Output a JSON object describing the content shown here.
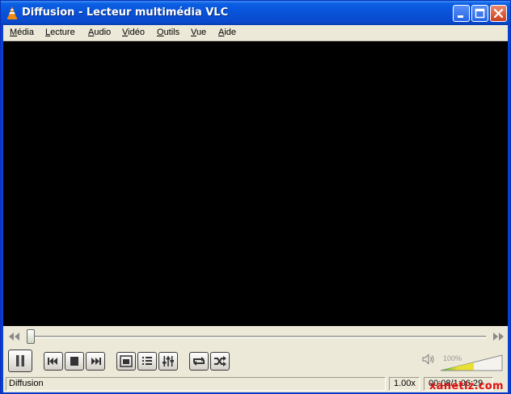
{
  "window": {
    "title": "Diffusion - Lecteur multimédia VLC",
    "icon": "vlc-cone-icon"
  },
  "menu": [
    {
      "accel": "M",
      "rest": "édia"
    },
    {
      "accel": "L",
      "rest": "ecture"
    },
    {
      "accel": "A",
      "rest": "udio"
    },
    {
      "accel": "V",
      "rest": "idéo"
    },
    {
      "accel": "O",
      "rest": "utils"
    },
    {
      "accel": "V",
      "rest": "ue"
    },
    {
      "accel": "A",
      "rest": "ide"
    }
  ],
  "playback": {
    "progress_fraction": 0.004
  },
  "controls": {
    "pause": "pause-icon",
    "previous": "previous-icon",
    "stop": "stop-icon",
    "next": "next-icon",
    "fullscreen": "fullscreen-icon",
    "playlist": "playlist-icon",
    "extended": "equalizer-icon",
    "loop": "loop-icon",
    "shuffle": "shuffle-icon"
  },
  "volume": {
    "label": "100%",
    "level": 1.0
  },
  "status": {
    "text": "Diffusion",
    "speed": "1.00x",
    "time": "00:08/1:06:29"
  },
  "watermark": "xanetiz.com",
  "colors": {
    "titlebar": "#0852d8",
    "video_bg": "#000000",
    "client_bg": "#ece9d8",
    "watermark": "#e01010"
  }
}
